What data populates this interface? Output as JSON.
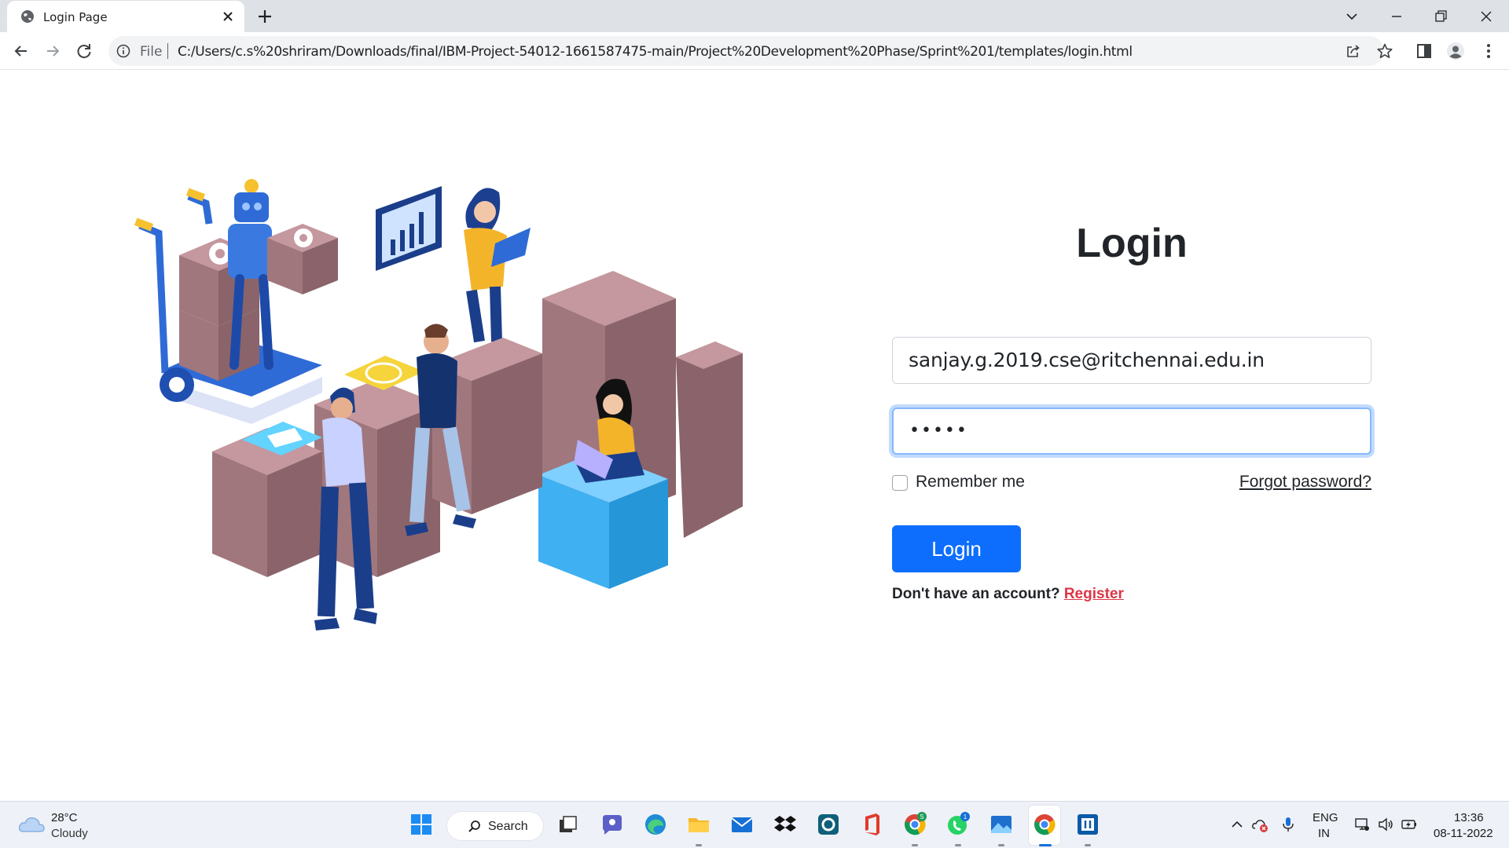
{
  "browser": {
    "tab_title": "Login Page",
    "scheme_label": "File",
    "url": "C:/Users/c.s%20shriram/Downloads/final/IBM-Project-54012-1661587475-main/Project%20Development%20Phase/Sprint%201/templates/login.html"
  },
  "login": {
    "title": "Login",
    "email_value": "sanjay.g.2019.cse@ritchennai.edu.in",
    "password_masked": "•••••",
    "remember_label": "Remember me",
    "forgot_label": "Forgot password?",
    "button_label": "Login",
    "no_account_text": "Don't have an account?",
    "register_label": "Register"
  },
  "taskbar": {
    "weather_temp": "28°C",
    "weather_condition": "Cloudy",
    "search_label": "Search",
    "chrome_badge": "S",
    "whatsapp_badge": "1",
    "language_line1": "ENG",
    "language_line2": "IN",
    "time": "13:36",
    "date": "08-11-2022"
  },
  "colors": {
    "primary": "#0d6efd",
    "register_link": "#dc3545",
    "focus_ring": "#86b7fe"
  },
  "icons": [
    "globe-icon",
    "close-icon",
    "plus-icon",
    "back-icon",
    "forward-icon",
    "reload-icon",
    "info-icon",
    "share-icon",
    "star-icon",
    "side-panel-icon",
    "profile-icon",
    "menu-icon",
    "weather-cloud-icon",
    "windows-start-icon",
    "search-icon"
  ]
}
